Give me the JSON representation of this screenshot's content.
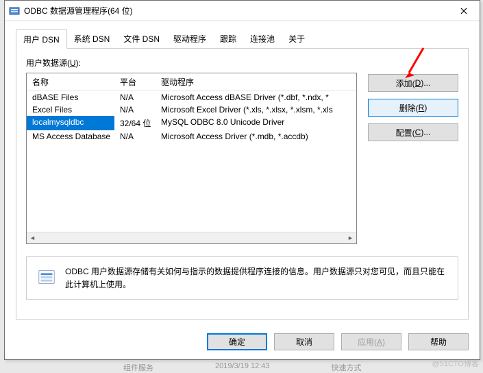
{
  "window": {
    "title": "ODBC 数据源管理程序(64 位)"
  },
  "tabs": [
    {
      "label": "用户 DSN",
      "active": true
    },
    {
      "label": "系统 DSN"
    },
    {
      "label": "文件 DSN"
    },
    {
      "label": "驱动程序"
    },
    {
      "label": "跟踪"
    },
    {
      "label": "连接池"
    },
    {
      "label": "关于"
    }
  ],
  "group_label_prefix": "用户数据源(",
  "group_label_key": "U",
  "group_label_suffix": "):",
  "columns": {
    "name": "名称",
    "platform": "平台",
    "driver": "驱动程序"
  },
  "rows": [
    {
      "name": "dBASE Files",
      "platform": "N/A",
      "driver": "Microsoft Access dBASE Driver (*.dbf, *.ndx, *",
      "selected": false
    },
    {
      "name": "Excel Files",
      "platform": "N/A",
      "driver": "Microsoft Excel Driver (*.xls, *.xlsx, *.xlsm, *.xls",
      "selected": false
    },
    {
      "name": "localmysqldbc",
      "platform": "32/64 位",
      "driver": "MySQL ODBC 8.0 Unicode Driver",
      "selected": true
    },
    {
      "name": "MS Access Database",
      "platform": "N/A",
      "driver": "Microsoft Access Driver (*.mdb, *.accdb)",
      "selected": false
    }
  ],
  "side": {
    "add_pre": "添加(",
    "add_key": "D",
    "add_post": ")...",
    "remove_pre": "删除(",
    "remove_key": "R",
    "remove_post": ")",
    "config_pre": "配置(",
    "config_key": "C",
    "config_post": ")..."
  },
  "info_text": "ODBC 用户数据源存储有关如何与指示的数据提供程序连接的信息。用户数据源只对您可见，而且只能在此计算机上使用。",
  "bottom": {
    "ok": "确定",
    "cancel": "取消",
    "apply_pre": "应用(",
    "apply_key": "A",
    "apply_post": ")",
    "help": "帮助"
  },
  "watermark": "@51CTO博客",
  "bg": {
    "svc": "组件服务",
    "time": "2019/3/19 12:43",
    "mode": "快速方式"
  }
}
